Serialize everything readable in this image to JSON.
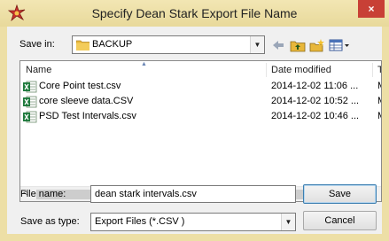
{
  "dialog": {
    "title": "Specify Dean Stark Export File Name",
    "close_label": "×"
  },
  "save_in": {
    "label": "Save in:",
    "value": "BACKUP"
  },
  "toolbar": {
    "icons": [
      "back-arrow-icon",
      "up-folder-icon",
      "new-folder-icon",
      "view-menu-icon"
    ]
  },
  "file_list": {
    "columns": [
      "Name",
      "Date modified",
      "Ty"
    ],
    "rows": [
      {
        "name": "Core Point test.csv",
        "date": "2014-12-02 11:06 ...",
        "type": "M"
      },
      {
        "name": "core sleeve data.CSV",
        "date": "2014-12-02 10:52 ...",
        "type": "M"
      },
      {
        "name": "PSD Test Intervals.csv",
        "date": "2014-12-02 10:46 ...",
        "type": "M"
      }
    ],
    "scroll_left": "<"
  },
  "file_name": {
    "label": "File name:",
    "value": "dean stark intervals.csv"
  },
  "save_as_type": {
    "label": "Save as type:",
    "value": "Export Files (*.CSV )"
  },
  "buttons": {
    "save": "Save",
    "cancel": "Cancel"
  },
  "colors": {
    "titlebar": "#eddfa6",
    "close": "#c84036",
    "folder": "#e8b73a",
    "excel_green": "#1f7a3d"
  }
}
